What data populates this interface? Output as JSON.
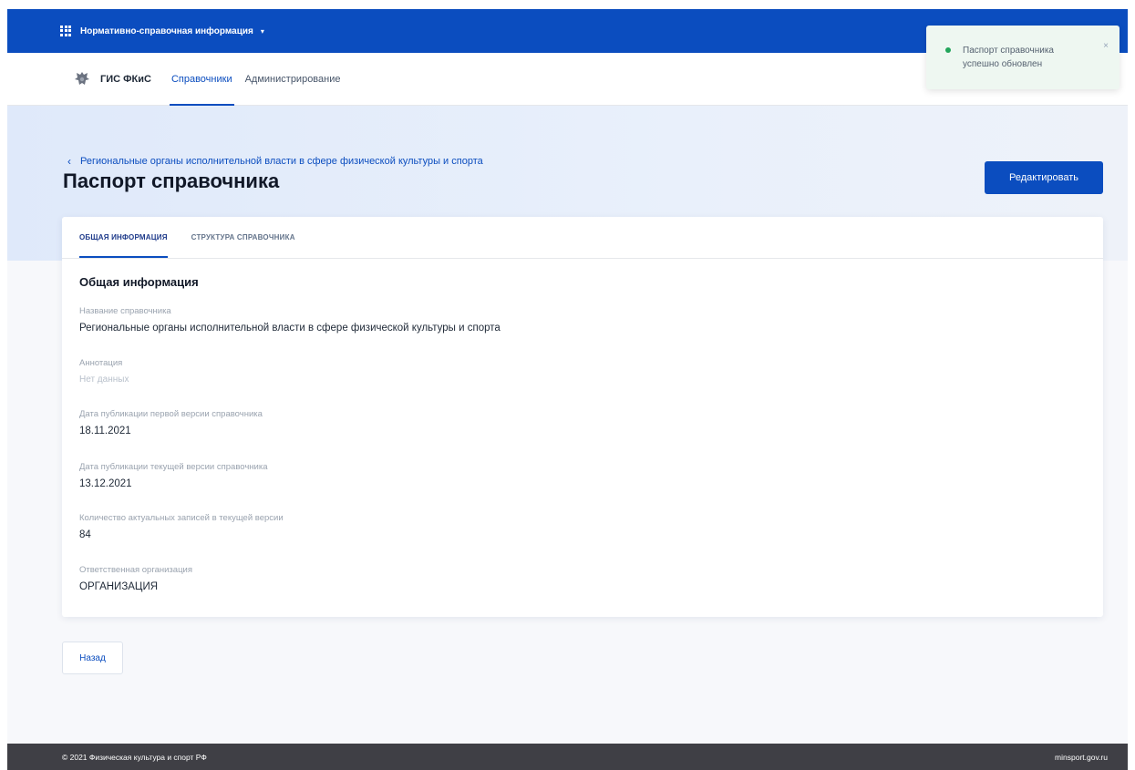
{
  "topbar": {
    "title": "Нормативно-справочная информация",
    "chevron": "▾",
    "icon": "grid-icon"
  },
  "navbar": {
    "brand": "ГИС ФКиС",
    "links": [
      {
        "label": "Справочники",
        "active": true
      },
      {
        "label": "Администрирование",
        "active": false
      }
    ]
  },
  "breadcrumb": {
    "chevron": "‹",
    "label": "Региональные органы исполнительной власти в сфере физической культуры и спорта"
  },
  "page": {
    "title": "Паспорт справочника",
    "edit_button": "Редактировать"
  },
  "tabs": [
    {
      "label": "ОБЩАЯ ИНФОРМАЦИЯ",
      "active": true
    },
    {
      "label": "СТРУКТУРА СПРАВОЧНИКА",
      "active": false
    }
  ],
  "section": {
    "title": "Общая информация",
    "fields": [
      {
        "label": "Название справочника",
        "value": "Региональные органы исполнительной власти в сфере физической культуры и спорта"
      },
      {
        "label": "Аннотация",
        "value": "Нет данных"
      },
      {
        "label": "Дата публикации первой версии справочника",
        "value": "18.11.2021"
      },
      {
        "label": "Дата публикации текущей версии справочника",
        "value": "13.12.2021"
      },
      {
        "label": "Количество актуальных записей в текущей версии",
        "value": "84"
      },
      {
        "label": "Ответственная организация",
        "value": "ОРГАНИЗАЦИЯ"
      }
    ]
  },
  "back_button": "Назад",
  "footer": {
    "copyright": "© 2021 Физическая культура и спорт РФ",
    "link": "minsport.gov.ru"
  },
  "toast": {
    "message": "Паспорт справочника успешно обновлен",
    "close": "×",
    "status_color": "#22a55b"
  },
  "colors": {
    "primary": "#0b4dbf",
    "footer": "#3f3f45"
  }
}
